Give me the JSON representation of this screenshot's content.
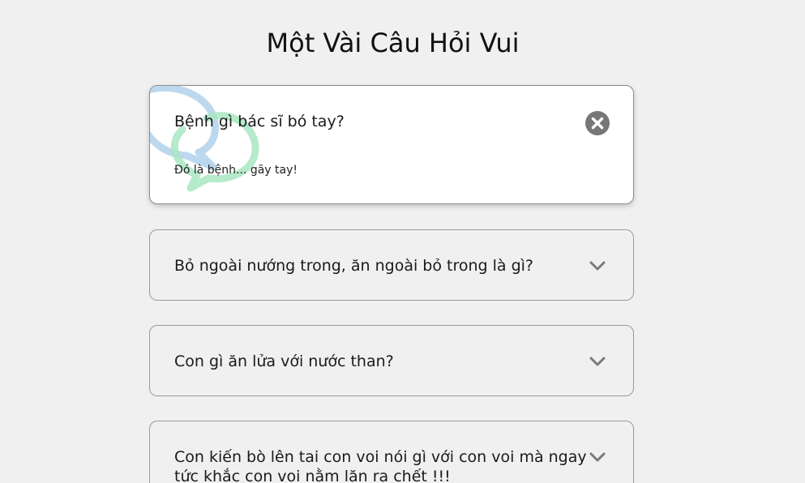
{
  "page": {
    "title": "Một Vài Câu Hỏi Vui"
  },
  "colors": {
    "background": "#f0f0f0",
    "card_active": "#ffffff",
    "close_icon": "#777777",
    "chevron": "#7a7a7a",
    "deco_blue": "#bcd8ee",
    "deco_green": "#a8e6c2"
  },
  "faqs": [
    {
      "question": "Bệnh gì bác sĩ bó tay?",
      "answer": "Đó là bệnh... gãy tay!",
      "expanded": true,
      "icon": "close-icon"
    },
    {
      "question": "Bỏ ngoài nướng trong, ăn ngoài bỏ trong là gì?",
      "expanded": false,
      "icon": "chevron-down-icon"
    },
    {
      "question": "Con gì ăn lửa với nước than?",
      "expanded": false,
      "icon": "chevron-down-icon"
    },
    {
      "question": "Con kiến bò lên tai con voi nói gì với con voi mà ngay tức khắc con voi nằm lăn ra chết !!!",
      "expanded": false,
      "icon": "chevron-down-icon"
    }
  ]
}
